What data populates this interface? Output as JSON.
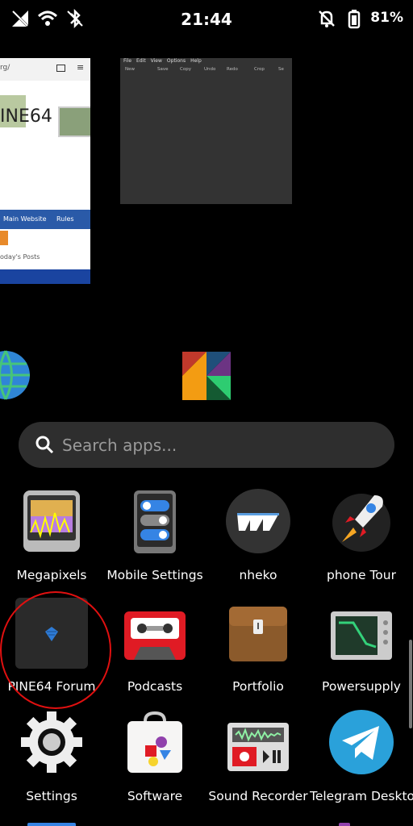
{
  "status": {
    "time": "21:44",
    "battery": "81%"
  },
  "thumb1": {
    "url_fragment": "rg/",
    "brand": "INE64",
    "nav": [
      "Main Website",
      "Rules"
    ],
    "posts": "oday's Posts"
  },
  "thumb2": {
    "menu": [
      "File",
      "Edit",
      "View",
      "Options",
      "Help"
    ],
    "tools": [
      "New",
      "Save",
      "Copy",
      "Undo",
      "Redo",
      "Crop",
      "Se"
    ]
  },
  "search": {
    "placeholder": "Search apps..."
  },
  "apps": [
    {
      "label": "Megapixels"
    },
    {
      "label": "Mobile Settings"
    },
    {
      "label": "nheko"
    },
    {
      "label": "phone Tour"
    },
    {
      "label": "PINE64 Forum"
    },
    {
      "label": "Podcasts"
    },
    {
      "label": "Portfolio"
    },
    {
      "label": "Powersupply"
    },
    {
      "label": "Settings"
    },
    {
      "label": "Software"
    },
    {
      "label": "Sound Recorder"
    },
    {
      "label": "Telegram Desktop"
    }
  ]
}
